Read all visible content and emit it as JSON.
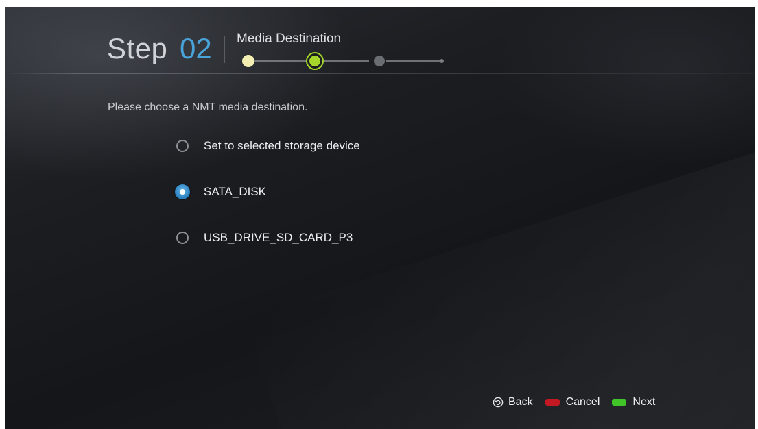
{
  "header": {
    "step_word": "Step",
    "step_number": "02",
    "step_title": "Media Destination",
    "progress": {
      "total_steps": 4,
      "current_step": 2
    }
  },
  "main": {
    "instruction": "Please choose a NMT media destination.",
    "options": [
      {
        "label": "Set to selected storage device",
        "selected": false
      },
      {
        "label": "SATA_DISK",
        "selected": true
      },
      {
        "label": "USB_DRIVE_SD_CARD_P3",
        "selected": false
      }
    ]
  },
  "footer": {
    "back_label": "Back",
    "cancel_label": "Cancel",
    "next_label": "Next",
    "back_icon": "remote-return-icon",
    "cancel_key_icon": "red-key-icon",
    "next_key_icon": "green-key-icon",
    "colors": {
      "cancel_key": "#c0121b",
      "next_key": "#39c21f"
    }
  },
  "colors": {
    "accent": "#4aa3d8",
    "progress_done": "#f3efb2",
    "progress_current": "#a6d62a",
    "progress_pending": "#6a6d72"
  }
}
